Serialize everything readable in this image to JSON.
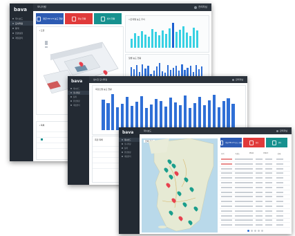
{
  "brand": {
    "logo": "bava"
  },
  "windows": [
    {
      "id": "w1",
      "header_title": "모니터링",
      "user_label": "관리자님",
      "nav": [
        "대시보드",
        "모니터링",
        "통계",
        "환경설정",
        "계정관리"
      ],
      "active_nav": 1,
      "tiles": [
        {
          "label": "평균 PM 2.5 농도 현황",
          "color": "#2d5bb3"
        },
        {
          "label": "경보 현황",
          "color": "#e03a3a"
        },
        {
          "label": "센서 현황",
          "color": "#17918f"
        }
      ],
      "chart1": {
        "title": "시간대별 농도 추이",
        "bar_color": "#38d1e3",
        "highlight_color": "#1b5fd0",
        "highlight_index": 12,
        "values": [
          22,
          35,
          28,
          40,
          31,
          26,
          45,
          38,
          30,
          42,
          33,
          47,
          60,
          39,
          44,
          52,
          36,
          29,
          48,
          41
        ]
      },
      "chart2": {
        "title": "일별 농도 현황",
        "bar_color": "#2f6fd6",
        "values": [
          55,
          48,
          60,
          40,
          62,
          50,
          58,
          35,
          45,
          57,
          66,
          42,
          39,
          61,
          47,
          53,
          59,
          44,
          63,
          46,
          52,
          58,
          41,
          60,
          49,
          56
        ]
      }
    },
    {
      "id": "w2",
      "header_title": "실시간 모니터링",
      "user_label": "관리자님",
      "nav": [
        "대시보드",
        "모니터링",
        "통계",
        "환경설정",
        "계정관리"
      ],
      "active_nav": 1,
      "chart": {
        "title": "측정소별 농도 현황",
        "bar_color": "#2f6fd6",
        "values": [
          80,
          72,
          95,
          60,
          70,
          88,
          64,
          75,
          90,
          58,
          68,
          82,
          77,
          62,
          85,
          74,
          66,
          92,
          59,
          71,
          87,
          65,
          79,
          93,
          61,
          76,
          84,
          69
        ]
      },
      "table_title": "측정 목록"
    },
    {
      "id": "w3",
      "header_title": "대시보드",
      "user_label": "관리자님",
      "nav": [
        "대시보드",
        "모니터링",
        "통계",
        "환경설정",
        "계정관리"
      ],
      "active_nav": 0,
      "map_label": "전체 지도",
      "tiles": [
        {
          "label": "평균 PM 2.5 농도 현황",
          "color": "#2d5bb3"
        },
        {
          "label": "경보",
          "color": "#e03a3a"
        },
        {
          "label": "센서",
          "color": "#17918f"
        }
      ],
      "table_headers": [
        "지역",
        "측정소",
        "PM10",
        "PM2.5",
        "상태"
      ],
      "markers": {
        "red": "#e8414e",
        "teal": "#1a9e8c"
      }
    }
  ]
}
